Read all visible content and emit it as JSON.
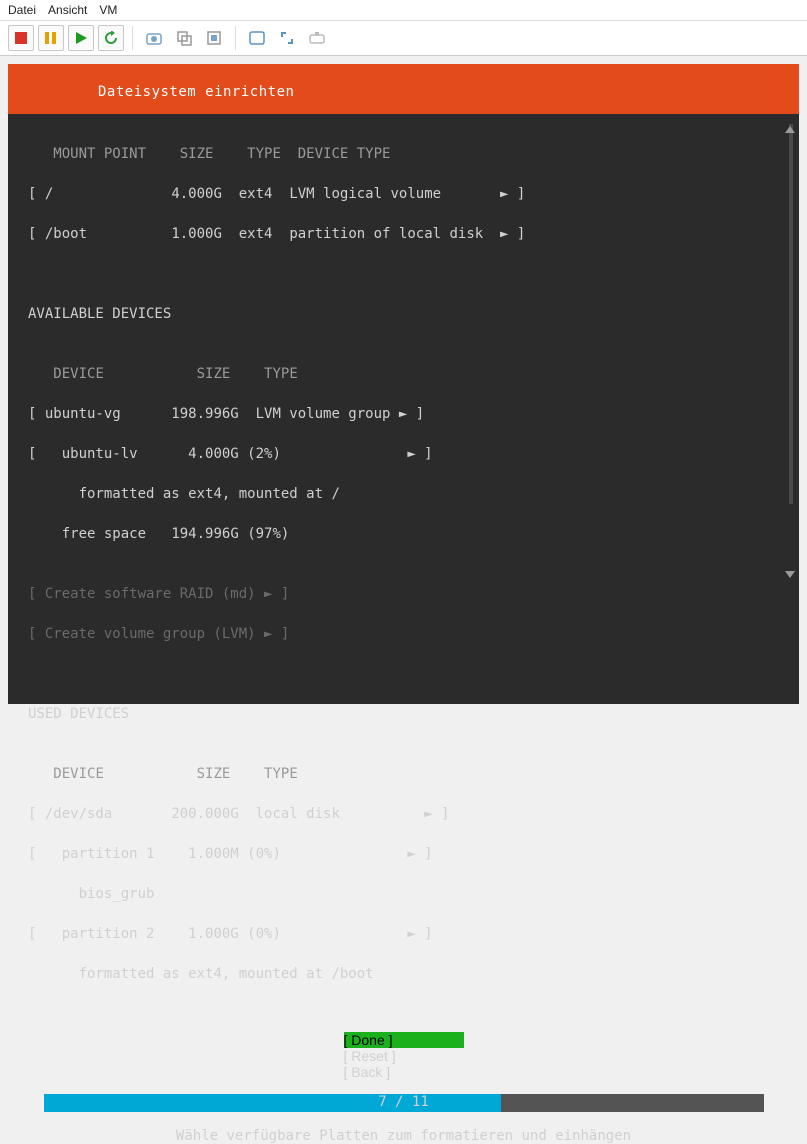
{
  "menu": {
    "file": "Datei",
    "view": "Ansicht",
    "vm": "VM"
  },
  "banner": {
    "title": "Dateisystem einrichten"
  },
  "mount": {
    "hdr_mount": "MOUNT POINT",
    "hdr_size": "SIZE",
    "hdr_type": "TYPE",
    "hdr_devtype": "DEVICE TYPE",
    "rows": [
      {
        "mp": "/",
        "size": "4.000G",
        "fs": "ext4",
        "dt": "LVM logical volume"
      },
      {
        "mp": "/boot",
        "size": "1.000G",
        "fs": "ext4",
        "dt": "partition of local disk"
      }
    ]
  },
  "avail": {
    "title": "AVAILABLE DEVICES",
    "hdr_dev": "DEVICE",
    "hdr_size": "SIZE",
    "hdr_type": "TYPE",
    "vg_name": "ubuntu-vg",
    "vg_size": "198.996G",
    "vg_type": "LVM volume group",
    "lv_name": "ubuntu-lv",
    "lv_size": "4.000G",
    "lv_pct": "(2%)",
    "lv_desc": "formatted as ext4, mounted at /",
    "free_label": "free space",
    "free_size": "194.996G",
    "free_pct": "(97%)",
    "raid": "Create software RAID (md)",
    "lvm": "Create volume group (LVM)"
  },
  "used": {
    "title": "USED DEVICES",
    "hdr_dev": "DEVICE",
    "hdr_size": "SIZE",
    "hdr_type": "TYPE",
    "disk": "/dev/sda",
    "disk_size": "200.000G",
    "disk_type": "local disk",
    "p1": "partition 1",
    "p1_size": "1.000M",
    "p1_pct": "(0%)",
    "p1_desc": "bios_grub",
    "p2": "partition 2",
    "p2_size": "1.000G",
    "p2_pct": "(0%)",
    "p2_desc": "formatted as ext4, mounted at /boot"
  },
  "actions": {
    "done": "Done",
    "reset": "Reset",
    "back": "Back"
  },
  "progress": {
    "label": "7 / 11",
    "percent": 63.6
  },
  "footer": {
    "text": "Wähle verfügbare Platten zum formatieren und einhängen"
  }
}
